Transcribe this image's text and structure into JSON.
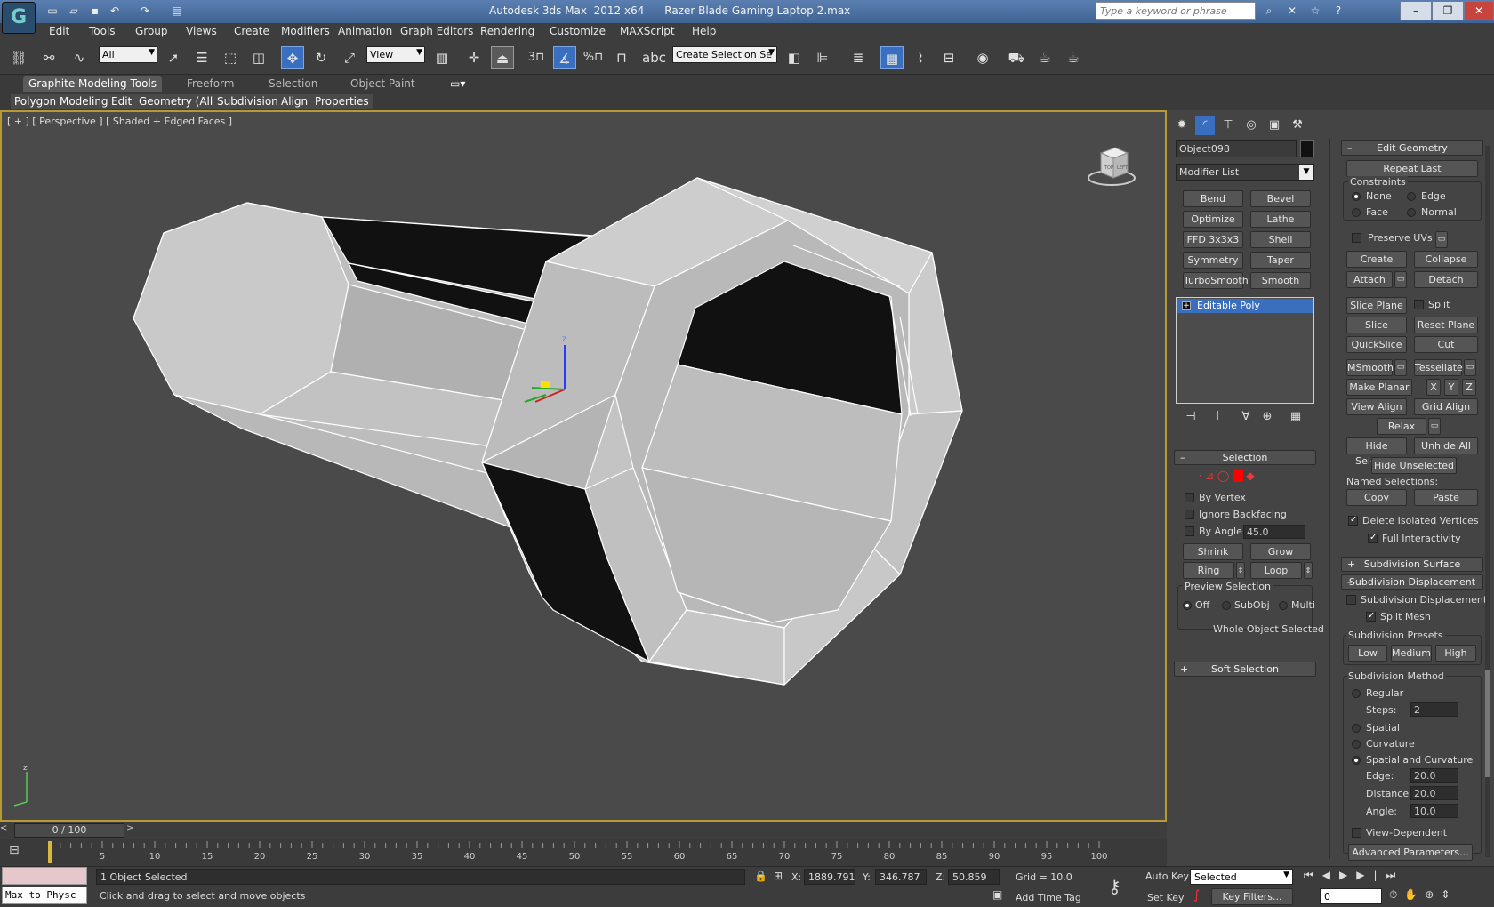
{
  "app": {
    "title": "Autodesk 3ds Max  2012 x64      Razer Blade Gaming Laptop 2.max",
    "search_placeholder": "Type a keyword or phrase"
  },
  "menu": [
    "Edit",
    "Tools",
    "Group",
    "Views",
    "Create",
    "Modifiers",
    "Animation",
    "Graph Editors",
    "Rendering",
    "Customize",
    "MAXScript",
    "Help"
  ],
  "toolbar": {
    "selection_filter": "All",
    "reference_coord": "View",
    "named_selection": "Create Selection Se",
    "snap_3": "3",
    "percent": "%"
  },
  "ribbon": {
    "tabs": [
      "Graphite Modeling Tools",
      "Freeform",
      "Selection",
      "Object Paint"
    ],
    "subtabs": [
      "Polygon Modeling",
      "Edit",
      "Geometry (All)",
      "Subdivision",
      "Align",
      "Properties"
    ]
  },
  "viewport": {
    "label": "[ + ] [ Perspective ] [ Shaded + Edged Faces ]",
    "viewcube_labels": [
      "TOP",
      "LEFT"
    ],
    "gizmo_z": "z",
    "mini_axis_z": "z"
  },
  "command_panel": {
    "object_name": "Object098",
    "modifier_list": "Modifier List",
    "modifier_buttons": [
      "Bend",
      "Bevel",
      "Optimize",
      "Lathe",
      "FFD 3x3x3",
      "Shell",
      "Symmetry",
      "Taper",
      "TurboSmooth",
      "Smooth"
    ],
    "stack_item": "Editable Poly",
    "selection": {
      "title": "Selection",
      "by_vertex": "By Vertex",
      "ignore_backfacing": "Ignore Backfacing",
      "by_angle": "By Angle:",
      "angle_value": "45.0",
      "shrink": "Shrink",
      "grow": "Grow",
      "ring": "Ring",
      "loop": "Loop",
      "preview_title": "Preview Selection",
      "preview_off": "Off",
      "preview_subobj": "SubObj",
      "preview_multi": "Multi",
      "status": "Whole Object Selected"
    },
    "soft_selection": "Soft Selection"
  },
  "edit_geometry": {
    "title": "Edit Geometry",
    "repeat_last": "Repeat Last",
    "constraints_title": "Constraints",
    "c_none": "None",
    "c_edge": "Edge",
    "c_face": "Face",
    "c_normal": "Normal",
    "preserve_uvs": "Preserve UVs",
    "create": "Create",
    "collapse": "Collapse",
    "attach": "Attach",
    "detach": "Detach",
    "slice_plane": "Slice Plane",
    "split": "Split",
    "slice": "Slice",
    "reset_plane": "Reset Plane",
    "quickslice": "QuickSlice",
    "cut": "Cut",
    "msmooth": "MSmooth",
    "tessellate": "Tessellate",
    "make_planar": "Make Planar",
    "x": "X",
    "y": "Y",
    "z": "Z",
    "view_align": "View Align",
    "grid_align": "Grid Align",
    "relax": "Relax",
    "hide_selected": "Hide Selected",
    "unhide_all": "Unhide All",
    "hide_unselected": "Hide Unselected",
    "named_selections": "Named Selections:",
    "copy": "Copy",
    "paste": "Paste",
    "delete_isolated": "Delete Isolated Vertices",
    "full_interactivity": "Full Interactivity",
    "subdivision_surface": "Subdivision Surface",
    "subdivision_displacement": "Subdivision Displacement",
    "sd_checkbox": "Subdivision Displacement",
    "split_mesh": "Split Mesh",
    "presets_title": "Subdivision Presets",
    "low": "Low",
    "medium": "Medium",
    "high": "High",
    "method_title": "Subdivision Method",
    "regular": "Regular",
    "steps": "Steps:",
    "steps_value": "2",
    "spatial": "Spatial",
    "curvature": "Curvature",
    "spatial_curv": "Spatial and Curvature",
    "edge": "Edge:",
    "edge_value": "20.0",
    "distance": "Distance:",
    "distance_value": "20.0",
    "angle": "Angle:",
    "angle_value": "10.0",
    "view_dependent": "View-Dependent",
    "advanced": "Advanced Parameters..."
  },
  "timeline": {
    "frame": "0 / 100",
    "ticks": [
      "0",
      "5",
      "10",
      "15",
      "20",
      "25",
      "30",
      "35",
      "40",
      "45",
      "50",
      "55",
      "60",
      "65",
      "70",
      "75",
      "80",
      "85",
      "90",
      "95",
      "100"
    ]
  },
  "status": {
    "script": "Max to Physc",
    "selected": "1 Object Selected",
    "prompt": "Click and drag to select and move objects",
    "x_label": "X:",
    "x_value": "1889.791",
    "y_label": "Y:",
    "y_value": "346.787",
    "z_label": "Z:",
    "z_value": "50.859",
    "grid": "Grid = 10.0",
    "add_time_tag": "Add Time Tag",
    "auto_key": "Auto Key",
    "set_key": "Set Key",
    "key_mode": "Selected",
    "key_filters": "Key Filters...",
    "current_frame": "0"
  },
  "colors": {
    "viewport_bg": "#4a4a4a",
    "active_border": "#b79a34",
    "model_face": "#c8c8c8",
    "model_dark": "#101010",
    "selection_blue": "#3a6fc0"
  }
}
